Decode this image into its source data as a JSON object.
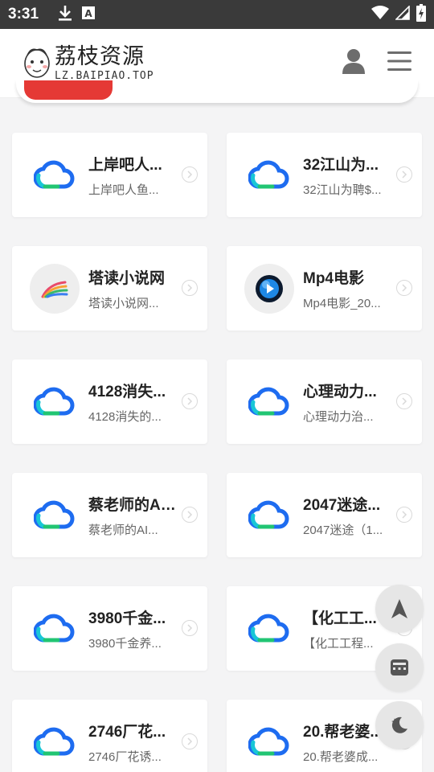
{
  "status_bar": {
    "time": "3:31",
    "left_icons": [
      "download-icon",
      "a-badge-icon"
    ],
    "right_icons": [
      "wifi-icon",
      "signal-icon",
      "battery-icon"
    ]
  },
  "header": {
    "logo_title": "荔枝资源",
    "logo_subtitle": "LZ.BAIPIAO.TOP",
    "actions": [
      "user-icon",
      "menu-icon"
    ]
  },
  "cards": [
    {
      "title": "上岸吧人...",
      "desc": "上岸吧人鱼...",
      "icon": "cloud-icon"
    },
    {
      "title": "32江山为...",
      "desc": "32江山为聘$...",
      "icon": "cloud-icon"
    },
    {
      "title": "塔读小说网",
      "desc": "塔读小说网...",
      "icon": "feather-logo-icon"
    },
    {
      "title": "Mp4电影",
      "desc": "Mp4电影_20...",
      "icon": "play-orb-icon"
    },
    {
      "title": "4128消失...",
      "desc": "4128消失的...",
      "icon": "cloud-icon"
    },
    {
      "title": "心理动力...",
      "desc": "心理动力治...",
      "icon": "cloud-icon"
    },
    {
      "title": "蔡老师的AI...",
      "desc": "蔡老师的AI...",
      "icon": "cloud-icon"
    },
    {
      "title": "2047迷途...",
      "desc": "2047迷途（1...",
      "icon": "cloud-icon"
    },
    {
      "title": "3980千金...",
      "desc": "3980千金养...",
      "icon": "cloud-icon"
    },
    {
      "title": "【化工工...",
      "desc": "【化工工程...",
      "icon": "cloud-icon"
    },
    {
      "title": "2746厂花...",
      "desc": "2746厂花诱...",
      "icon": "cloud-icon"
    },
    {
      "title": "20.帮老婆...",
      "desc": "20.帮老婆成...",
      "icon": "cloud-icon"
    }
  ],
  "floating_buttons": [
    "navigate-up-icon",
    "calculator-icon",
    "night-mode-icon"
  ],
  "colors": {
    "status_bar_bg": "#3a3a3a",
    "page_bg": "#f4f4f5",
    "card_bg": "#ffffff",
    "cloud_blue": "#1e6cf0",
    "cloud_cyan": "#19c6d6",
    "cloud_green": "#21c573",
    "banner_red": "#e53935"
  }
}
